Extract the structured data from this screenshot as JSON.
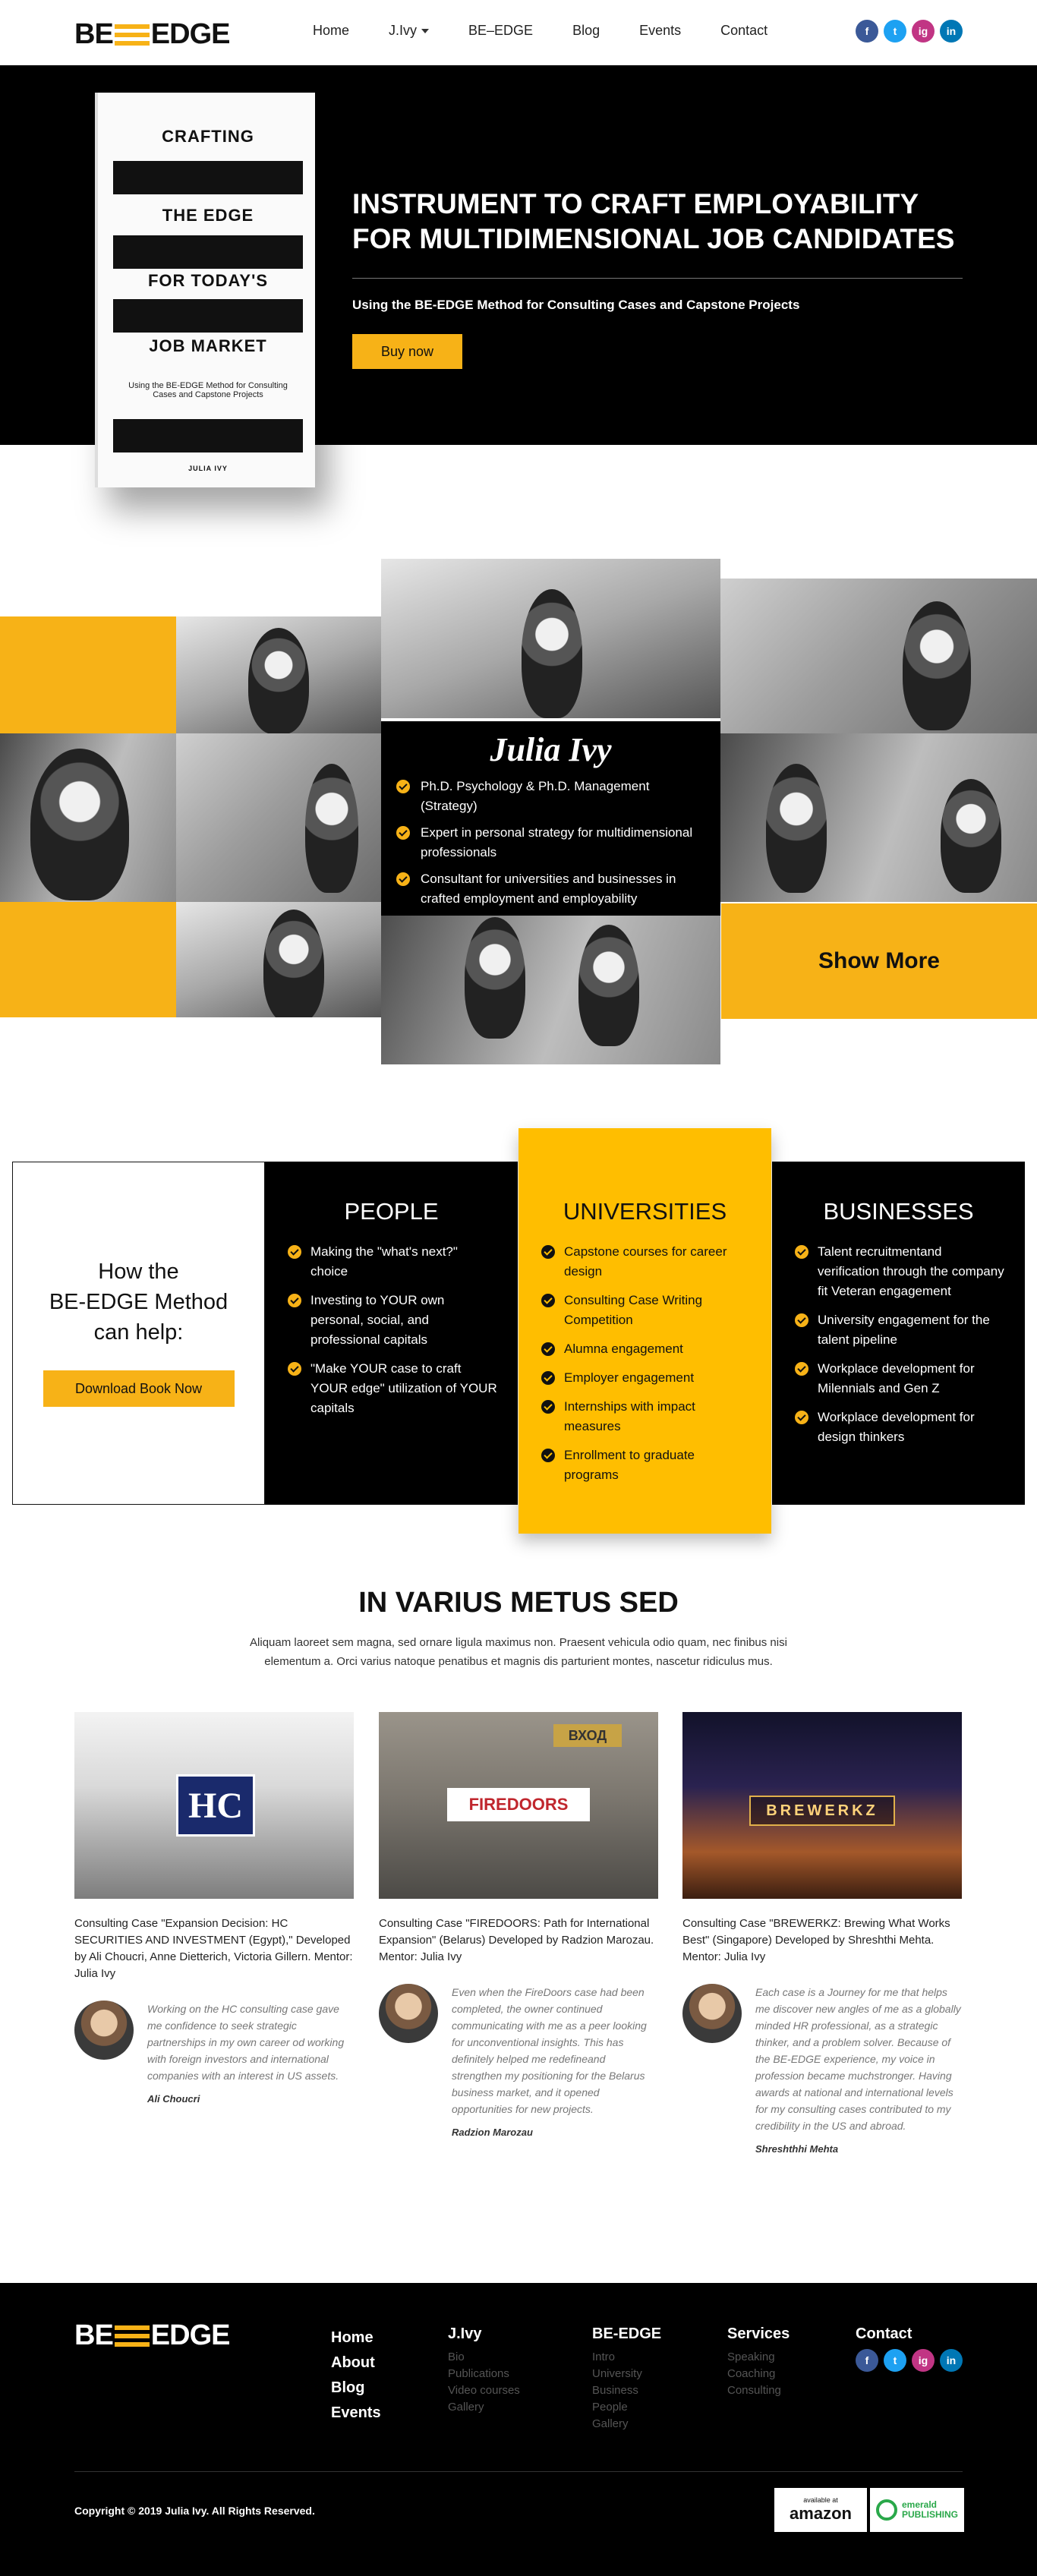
{
  "brand": {
    "logo_left": "BE",
    "logo_right": "EDGE",
    "accent": "#f7b217"
  },
  "nav": {
    "items": [
      "Home",
      "J.Ivy",
      "BE–EDGE",
      "Blog",
      "Events",
      "Contact"
    ],
    "dropdown_item": "J.Ivy"
  },
  "social": {
    "facebook": "f",
    "twitter": "t",
    "instagram": "ig",
    "linkedin": "in"
  },
  "hero": {
    "book": {
      "lines": [
        "CRAFTING",
        "THE EDGE",
        "FOR TODAY'S",
        "JOB MARKET"
      ],
      "subtitle": "Using the BE-EDGE Method for Consulting Cases and Capstone Projects",
      "author": "JULIA IVY"
    },
    "title": "INSTRUMENT TO CRAFT EMPLOYABILITY FOR MULTIDIMENSIONAL JOB CANDIDATES",
    "subtitle": "Using the BE-EDGE Method for Consulting Cases and Capstone Projects",
    "cta": "Buy now"
  },
  "bio": {
    "name": "Julia Ivy",
    "points": [
      "Ph.D. Psychology & Ph.D. Management (Strategy)",
      "Expert in personal strategy for multidimensional professionals",
      "Consultant for universities and businesses in crafted employment and employability"
    ],
    "show_more": "Show More"
  },
  "how": {
    "title_line1": "How the",
    "title_line2": "BE-EDGE Method",
    "title_line3": "can help:",
    "download": "Download Book Now",
    "columns": [
      {
        "title": "PEOPLE",
        "items": [
          "Making the \"what's next?\" choice",
          "Investing to YOUR own personal, social, and professional capitals",
          "\"Make YOUR case to craft YOUR edge\" utilization of YOUR capitals"
        ]
      },
      {
        "title": "UNIVERSITIES",
        "items": [
          "Capstone courses for career design",
          "Consulting Case Writing Competition",
          "Alumna engagement",
          "Employer engagement",
          "Internships with impact measures",
          "Enrollment to graduate programs"
        ]
      },
      {
        "title": "BUSINESSES",
        "items": [
          "Talent recruitmentand verification through the company fit Veteran engagement",
          "University engagement for the talent pipeline",
          "Workplace development for Milennials and Gen Z",
          "Workplace development for design thinkers"
        ]
      }
    ]
  },
  "cases": {
    "heading": "IN VARIUS METUS SED",
    "lead": "Aliquam laoreet sem magna, sed ornare ligula maximus non. Praesent vehicula odio quam, nec finibus nisi elementum a. Orci varius natoque penatibus et magnis dis parturient montes, nascetur ridiculus mus.",
    "items": [
      {
        "logo": "HC",
        "caption": "Consulting Case \"Expansion Decision: HC SECURITIES AND INVESTMENT (Egypt),\" Developed by Ali Choucri, Anne Dietterich, Victoria Gillern. Mentor: Julia Ivy",
        "quote": "Working on the HC consulting case gave me confidence to seek strategic partnerships in my own career od working with foreign investors and international companies with an interest in US assets.",
        "author": "Ali Choucri"
      },
      {
        "logo": "FIREDOORS",
        "sign": "ВХОД",
        "caption": "Consulting Case \"FIREDOORS: Path for International Expansion\" (Belarus) Developed by Radzion Marozau. Mentor: Julia Ivy",
        "quote": "Even when the FireDoors case had been completed, the owner continued communicating with me as a peer looking for unconventional insights. This has definitely helped me redefineand strengthen my positioning for the Belarus business market, and it opened opportunities for new projects.",
        "author": "Radzion Marozau"
      },
      {
        "logo": "BREWERKZ",
        "caption": "Consulting Case \"BREWERKZ: Brewing What Works Best\" (Singapore) Developed by Shreshthi Mehta. Mentor: Julia Ivy",
        "quote": "Each case is a Journey for me that helps me discover new angles of me as a globally minded HR professional, as a strategic thinker, and a problem solver. Because of the BE-EDGE experience, my voice in profession became muchstronger. Having awards at national and international levels for my consulting cases contributed to my credibility in the US and abroad.",
        "author": "Shreshthhi Mehta"
      }
    ]
  },
  "footer": {
    "main_links": [
      "Home",
      "About",
      "Blog",
      "Events"
    ],
    "columns": [
      {
        "title": "J.Ivy",
        "links": [
          "Bio",
          "Publications",
          "Video courses",
          "Gallery"
        ]
      },
      {
        "title": "BE-EDGE",
        "links": [
          "Intro",
          "University",
          "Business",
          "People",
          "Gallery"
        ]
      },
      {
        "title": "Services",
        "links": [
          "Speaking",
          "Coaching",
          "Consulting"
        ]
      }
    ],
    "contact_title": "Contact",
    "copyright": "Copyright © 2019 Julia Ivy. All Rights Reserved.",
    "amazon_small": "available at",
    "amazon": "amazon",
    "emerald_line1": "emerald",
    "emerald_line2": "PUBLISHING"
  }
}
